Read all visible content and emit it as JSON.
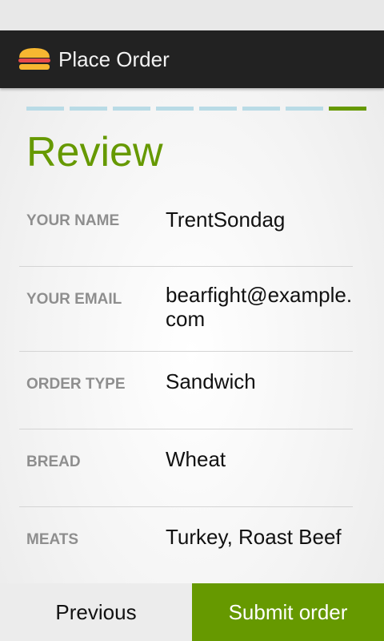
{
  "app": {
    "title": "Place Order",
    "icon": "burger-icon"
  },
  "progress": {
    "total_steps": 8,
    "current_step": 8,
    "colors": {
      "inactive": "#b9dbe6",
      "active": "#669900"
    }
  },
  "page": {
    "title": "Review"
  },
  "review_rows": [
    {
      "label": "YOUR NAME",
      "value": "TrentSondag"
    },
    {
      "label": "YOUR EMAIL",
      "value": "bearfight@example.com"
    },
    {
      "label": "ORDER TYPE",
      "value": "Sandwich"
    },
    {
      "label": "BREAD",
      "value": "Wheat"
    },
    {
      "label": "MEATS",
      "value": "Turkey, Roast Beef"
    }
  ],
  "buttons": {
    "previous": "Previous",
    "submit": "Submit order"
  },
  "colors": {
    "accent": "#669900",
    "action_bar": "#222222",
    "label": "#8e8e8e"
  }
}
